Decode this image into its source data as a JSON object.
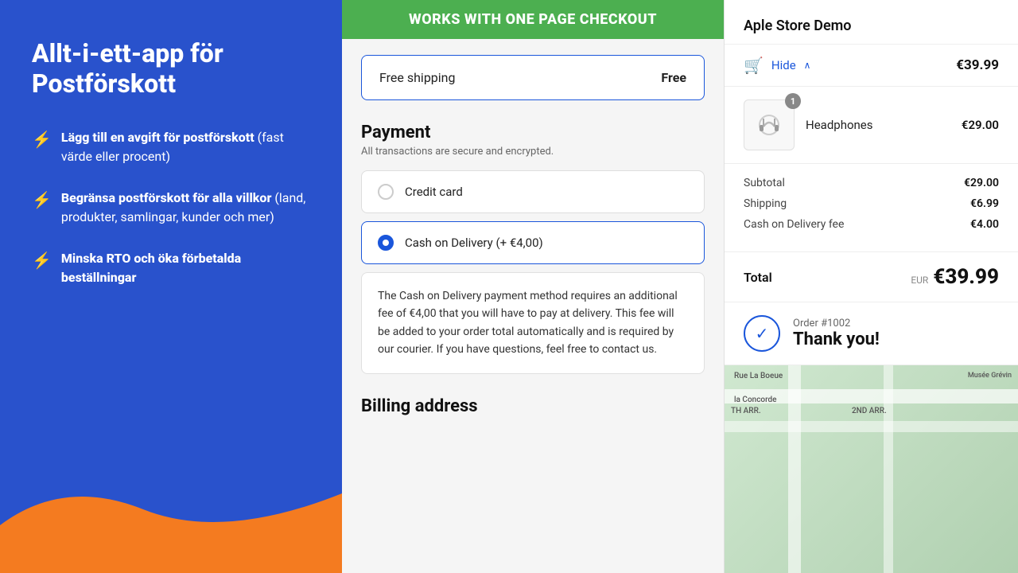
{
  "left": {
    "title": "Allt-i-ett-app för\nPostförskott",
    "features": [
      {
        "bold": "Lägg till en avgift för postförskott",
        "rest": " (fast värde eller procent)"
      },
      {
        "bold": "Begränsa postförskott för alla villkor",
        "rest": " (land, produkter, samlingar, kunder och mer)"
      },
      {
        "bold": "Minska RTO och öka förbetalda beställningar",
        "rest": ""
      }
    ]
  },
  "middle": {
    "badge": "WORKS WITH ONE PAGE CHECKOUT",
    "shipping": {
      "label": "Free shipping",
      "value": "Free"
    },
    "payment": {
      "title": "Payment",
      "subtitle": "All transactions are secure and encrypted.",
      "options": [
        {
          "label": "Credit card",
          "selected": false
        },
        {
          "label": "Cash on Delivery (+ €4,00)",
          "selected": true
        }
      ],
      "cod_info": "The Cash on Delivery payment method requires an additional fee of €4,00 that you will have to pay at delivery. This fee will be added to your order total automatically and is required by our courier. If you have questions, feel free to contact us."
    },
    "billing": {
      "title": "Billing address"
    }
  },
  "right": {
    "store_name": "Aple Store Demo",
    "cart": {
      "hide_label": "Hide",
      "total": "€39.99"
    },
    "product": {
      "name": "Headphones",
      "price": "€29.00",
      "badge": "1"
    },
    "summary": {
      "subtotal_label": "Subtotal",
      "subtotal_value": "€29.00",
      "shipping_label": "Shipping",
      "shipping_value": "€6.99",
      "cod_label": "Cash on Delivery fee",
      "cod_value": "€4.00"
    },
    "total": {
      "label": "Total",
      "currency": "EUR",
      "value": "€39.99"
    },
    "order": {
      "number": "Order #1002",
      "thank_you": "Thank you!"
    }
  }
}
